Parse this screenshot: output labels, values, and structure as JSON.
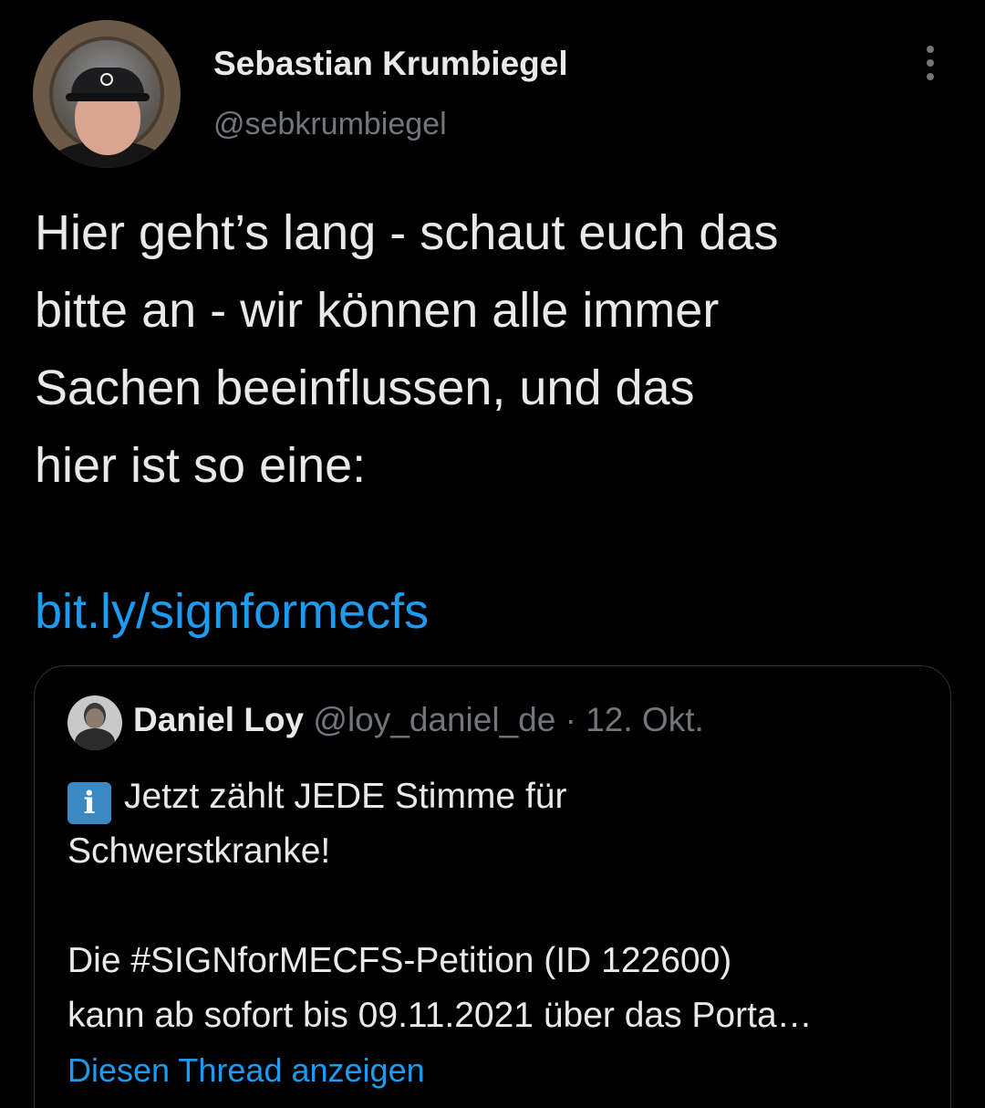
{
  "author": {
    "display_name": "Sebastian Krumbiegel",
    "handle": "@sebkrumbiegel"
  },
  "tweet": {
    "text": "Hier geht’s lang - schaut euch das\nbitte an - wir können alle immer\nSachen beeinflussen, und das\nhier ist so eine:",
    "link": "bit.ly/signformecfs"
  },
  "quoted_tweet": {
    "display_name": "Daniel Loy",
    "handle": "@loy_daniel_de",
    "separator": "·",
    "date": "12. Okt.",
    "info_icon_glyph": "i",
    "line1": "Jetzt zählt JEDE Stimme für",
    "line2": "Schwerstkranke!",
    "line3": "Die #SIGNforMECFS-Petition (ID 122600)",
    "line4": "kann ab sofort bis 09.11.2021 über das Porta…",
    "show_thread": "Diesen Thread anzeigen"
  },
  "icons": {
    "more": "more-vertical-icon",
    "info": "information-icon"
  },
  "colors": {
    "background": "#000000",
    "text": "#e7e9ea",
    "secondary": "#71767b",
    "link": "#1d9bf0",
    "border": "#2f3336",
    "info_badge": "#3b88c3"
  }
}
